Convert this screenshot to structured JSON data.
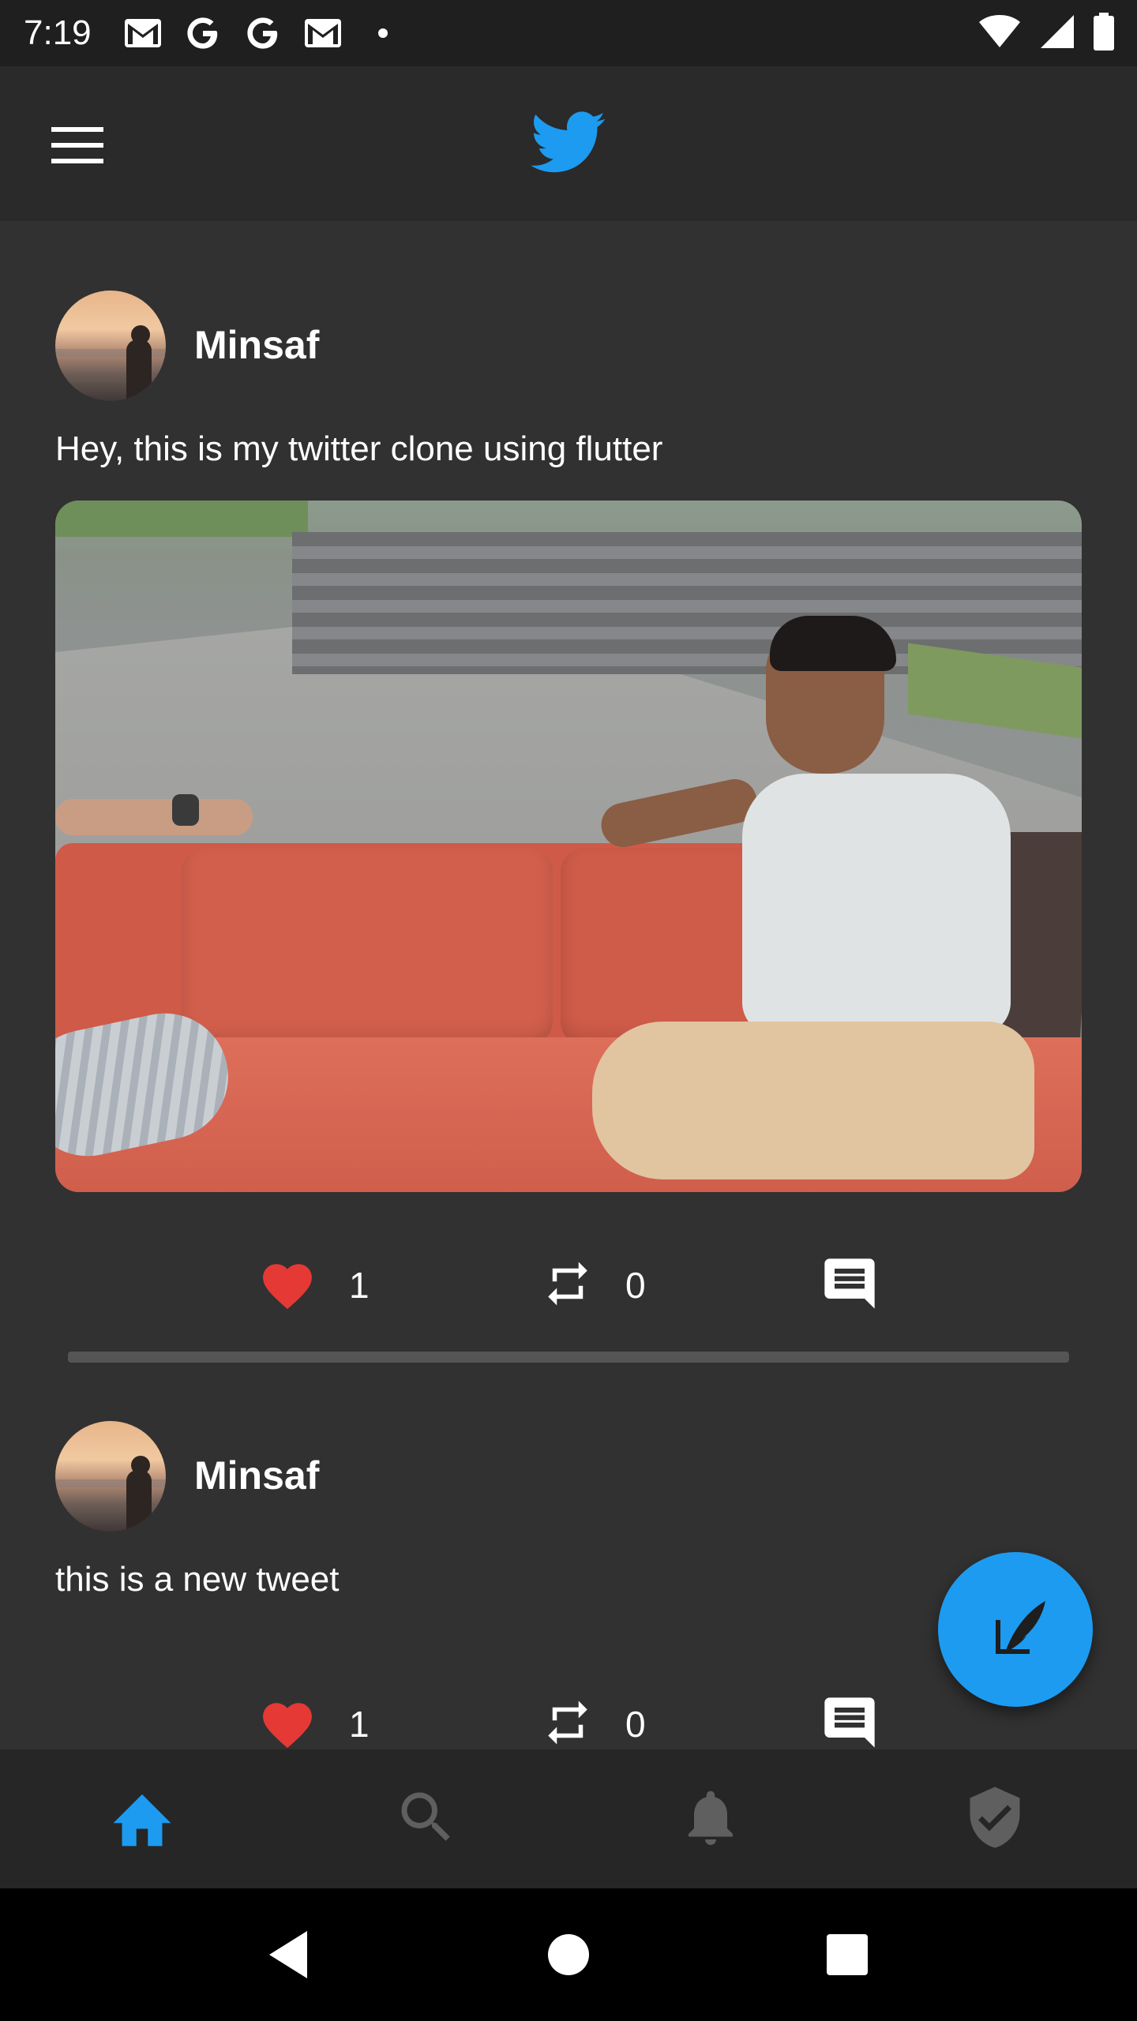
{
  "status_bar": {
    "time": "7:19",
    "left_icons": [
      "gmail-icon",
      "google-icon",
      "google-icon",
      "gmail-icon",
      "dot-icon"
    ],
    "right_icons": [
      "wifi-icon",
      "signal-icon",
      "battery-icon"
    ]
  },
  "app_bar": {
    "menu_icon": "hamburger-menu-icon",
    "logo_icon": "twitter-bird-icon",
    "accent_color": "#1d9bf0"
  },
  "feed": {
    "tweets": [
      {
        "username": "Minsaf",
        "text": "Hey, this is my twitter clone using flutter",
        "has_image": true,
        "likes": "1",
        "retweets": "0"
      },
      {
        "username": "Minsaf",
        "text": "this is a new tweet",
        "has_image": false,
        "likes": "1",
        "retweets": "0"
      }
    ],
    "icons": {
      "like": "heart-icon",
      "retweet": "retweet-icon",
      "comment": "comment-icon"
    },
    "like_color": "#e53935"
  },
  "fab": {
    "icon": "compose-tweet-icon",
    "color": "#1d9bf0"
  },
  "bottom_nav": {
    "items": [
      {
        "icon": "home-icon",
        "active": true
      },
      {
        "icon": "search-icon",
        "active": false
      },
      {
        "icon": "notifications-bell-icon",
        "active": false
      },
      {
        "icon": "verified-shield-icon",
        "active": false
      }
    ],
    "active_color": "#1d9bf0",
    "inactive_color": "#5f5f5f"
  },
  "system_nav": {
    "items": [
      "back-icon",
      "home-circle-icon",
      "recents-icon"
    ]
  }
}
